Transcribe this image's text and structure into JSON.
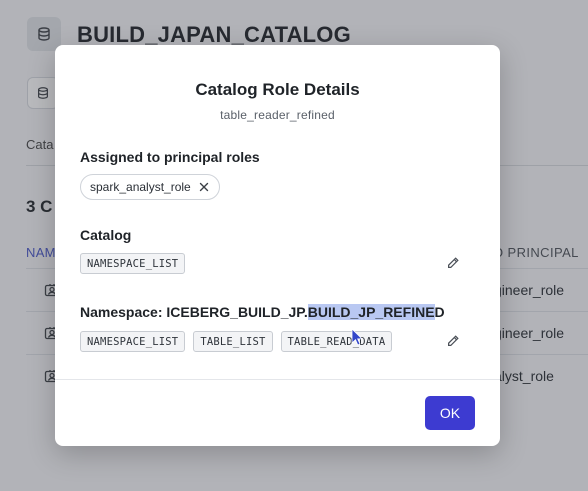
{
  "page": {
    "title": "BUILD_JAPAN_CATALOG",
    "tab_label": "Cata",
    "count_heading": "3 C",
    "table": {
      "col_name": "NAM",
      "col_principal": "O PRINCIPAL",
      "rows": [
        {
          "role": "gineer_role"
        },
        {
          "role": "gineer_role"
        },
        {
          "role": "alyst_role"
        }
      ]
    }
  },
  "modal": {
    "title": "Catalog Role Details",
    "subtitle": "table_reader_refined",
    "principal_section_label": "Assigned to principal roles",
    "principal_roles": [
      "spark_analyst_role"
    ],
    "catalog_section_label": "Catalog",
    "catalog_privileges": [
      "NAMESPACE_LIST"
    ],
    "namespace_label_prefix": "Namespace: ICEBERG_BUILD_JP.",
    "namespace_label_highlight": "BUILD_JP_REFINE",
    "namespace_label_suffix": "D",
    "namespace_privileges": [
      "NAMESPACE_LIST",
      "TABLE_LIST",
      "TABLE_READ_DATA"
    ],
    "ok_label": "OK"
  },
  "colors": {
    "accent": "#3d3bd1",
    "header_link": "#4654c9",
    "selection_highlight": "#b9c8f2"
  },
  "icons": {
    "catalog": "database-icon",
    "chip_remove": "close-icon",
    "edit": "pencil-icon",
    "row": "user-badge-icon"
  }
}
